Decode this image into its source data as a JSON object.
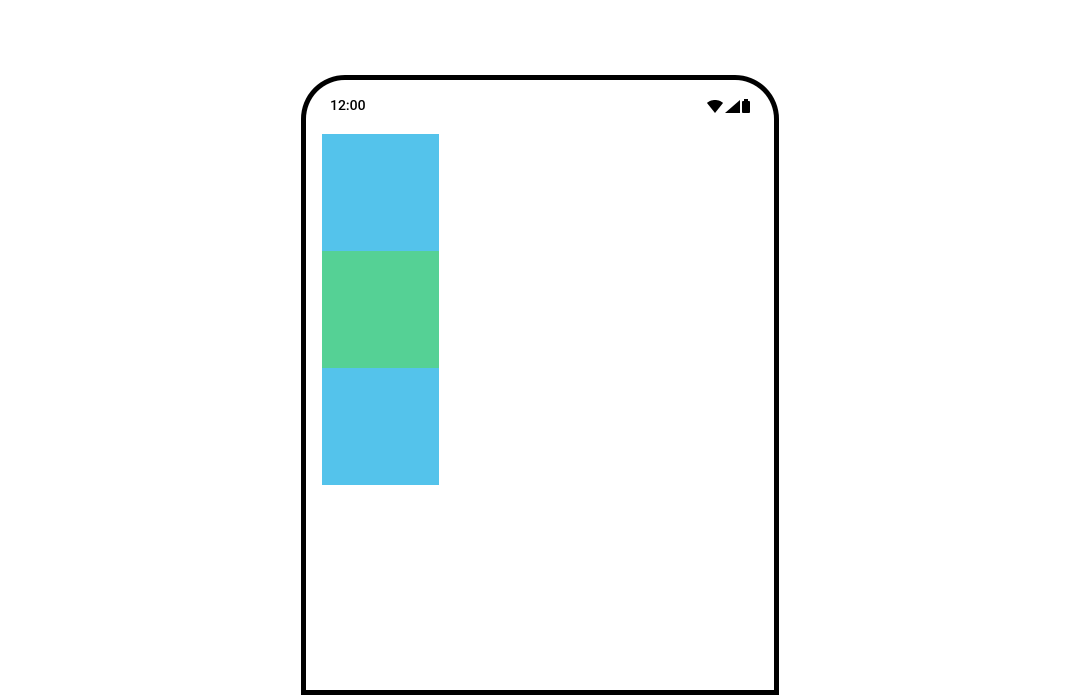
{
  "statusbar": {
    "time": "12:00"
  },
  "blocks": {
    "b1": {
      "color": "#54c3eb"
    },
    "b2": {
      "color": "#55d195"
    },
    "b3": {
      "color": "#54c3eb"
    }
  }
}
